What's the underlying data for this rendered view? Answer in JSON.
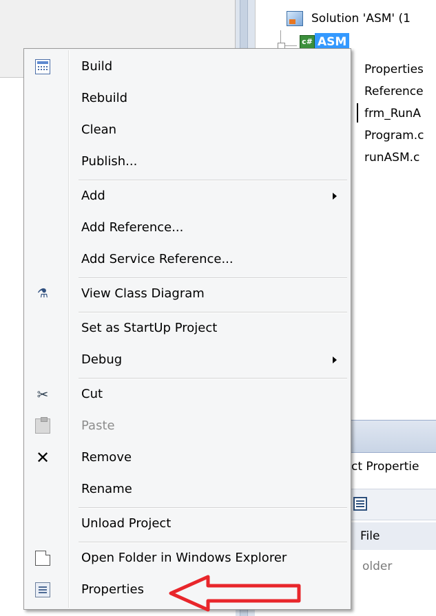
{
  "solution_explorer": {
    "solution_label": "Solution 'ASM' (1",
    "project_label": "ASM",
    "project_icon_text": "c#",
    "items": [
      "Properties",
      "Reference",
      "frm_RunA",
      "Program.c",
      "runASM.c"
    ]
  },
  "properties_panel": {
    "title": "ct Propertie",
    "file_label": "File",
    "folder_label": "older"
  },
  "context_menu": {
    "items": [
      {
        "label": "Build",
        "icon": "build-icon"
      },
      {
        "label": "Rebuild"
      },
      {
        "label": "Clean"
      },
      {
        "label": "Publish..."
      },
      {
        "label": "Add",
        "submenu": true
      },
      {
        "label": "Add Reference..."
      },
      {
        "label": "Add Service Reference..."
      },
      {
        "label": "View Class Diagram",
        "icon": "class-diagram-icon"
      },
      {
        "label": "Set as StartUp Project"
      },
      {
        "label": "Debug",
        "submenu": true
      },
      {
        "label": "Cut",
        "icon": "scissors-icon"
      },
      {
        "label": "Paste",
        "icon": "paste-icon",
        "disabled": true
      },
      {
        "label": "Remove",
        "icon": "remove-icon"
      },
      {
        "label": "Rename"
      },
      {
        "label": "Unload Project"
      },
      {
        "label": "Open Folder in Windows Explorer",
        "icon": "open-folder-icon"
      },
      {
        "label": "Properties",
        "icon": "properties-icon"
      }
    ]
  },
  "annotation": {
    "arrow_color": "#e8262b",
    "points_to": "Properties"
  }
}
